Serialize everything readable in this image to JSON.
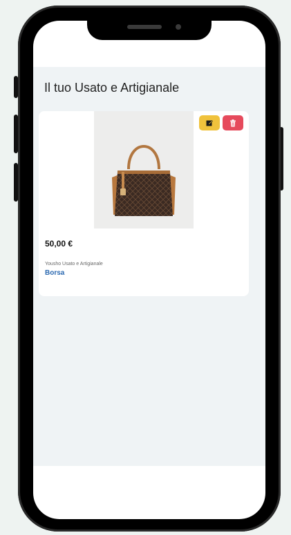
{
  "page": {
    "title": "Il tuo Usato e Artigianale"
  },
  "product": {
    "price": "50,00 €",
    "seller": "Yousho Usato e Artigianale",
    "name": "Borsa",
    "image_icon": "handbag-icon"
  },
  "actions": {
    "edit_icon": "edit-icon",
    "delete_icon": "trash-icon"
  },
  "colors": {
    "edit": "#f0c23c",
    "delete": "#e64a5c",
    "link": "#2a68b0",
    "background": "#eff3f5"
  }
}
